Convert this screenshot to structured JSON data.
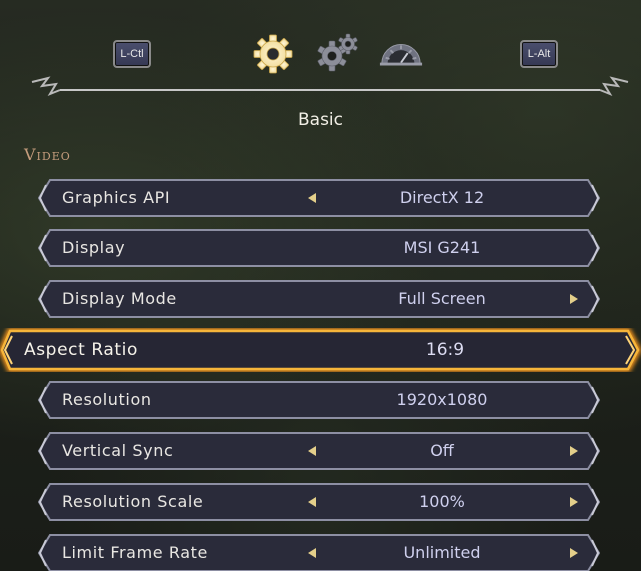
{
  "header": {
    "left_key": "L-Ctl",
    "right_key": "L-Alt",
    "tabs": [
      {
        "icon": "gear-icon",
        "active": true
      },
      {
        "icon": "gears-icon",
        "active": false
      },
      {
        "icon": "gauge-icon",
        "active": false
      }
    ]
  },
  "page_title": "Basic",
  "section_title": "Video",
  "settings": [
    {
      "label": "Graphics API",
      "value": "DirectX 12",
      "left_arrow": true,
      "right_arrow": false
    },
    {
      "label": "Display",
      "value": "MSI G241",
      "left_arrow": false,
      "right_arrow": false
    },
    {
      "label": "Display Mode",
      "value": "Full Screen",
      "left_arrow": false,
      "right_arrow": true
    },
    {
      "label": "Aspect Ratio",
      "value": "16:9",
      "left_arrow": false,
      "right_arrow": false,
      "selected": true
    },
    {
      "label": "Resolution",
      "value": "1920x1080",
      "left_arrow": false,
      "right_arrow": false
    },
    {
      "label": "Vertical Sync",
      "value": "Off",
      "left_arrow": true,
      "right_arrow": true
    },
    {
      "label": "Resolution Scale",
      "value": "100%",
      "left_arrow": true,
      "right_arrow": true
    },
    {
      "label": "Limit Frame Rate",
      "value": "Unlimited",
      "left_arrow": true,
      "right_arrow": true
    }
  ],
  "colors": {
    "row_fill": "#2a2b3a",
    "row_border": "#8d8fa3",
    "selected_glow": "#f2a227",
    "value_text": "#cfd0ee",
    "arrow": "#e4cf8a",
    "section_title": "#c49c7c"
  }
}
